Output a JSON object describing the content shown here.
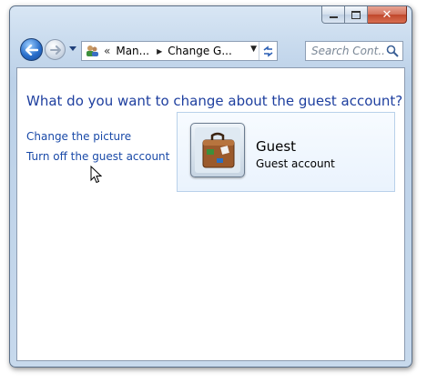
{
  "window": {
    "controls": {
      "minimize_icon": "minimize-icon",
      "maximize_icon": "maximize-icon",
      "close_glyph": "✕"
    }
  },
  "navigation": {
    "back_icon": "back-arrow-icon",
    "forward_icon": "forward-arrow-icon",
    "recent_icon": "chevron-down-icon"
  },
  "address_bar": {
    "chevron": "«",
    "crumbs": [
      "Man...",
      "Change G..."
    ],
    "separator": "▶",
    "dropdown": "▼",
    "refresh_icon": "refresh-icon"
  },
  "search": {
    "placeholder": "Search Cont...",
    "icon": "search-icon"
  },
  "main": {
    "heading": "What do you want to change about the guest account?",
    "links": [
      "Change the picture",
      "Turn off the guest account"
    ]
  },
  "account": {
    "name": "Guest",
    "type": "Guest account",
    "picture": "suitcase-icon"
  },
  "colors": {
    "heading": "#1e3f9f",
    "link": "#1a4aa8",
    "card_border": "#b9d1ea",
    "close_button": "#c0472b"
  }
}
